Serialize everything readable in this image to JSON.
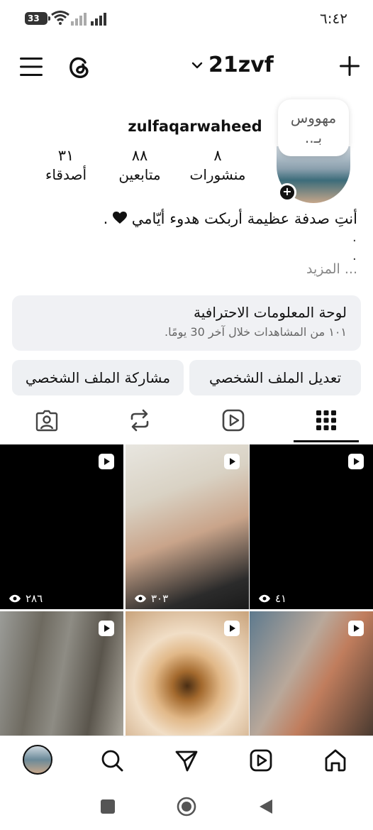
{
  "status_bar": {
    "battery": "33",
    "time": "٦:٤٢"
  },
  "header": {
    "username": "21zvf",
    "icons": [
      "menu-icon",
      "threads-icon",
      "chevron-down-icon",
      "plus-icon"
    ]
  },
  "profile": {
    "full_name": "zulfaqarwaheed",
    "note_line1": "مهووس",
    "note_line2": "بـ..",
    "stats": {
      "posts_value": "٨",
      "posts_label": "منشورات",
      "followers_value": "٨٨",
      "followers_label": "متابعين",
      "friends_value": "٣١",
      "friends_label": "أصدقاء"
    },
    "bio": "أنتِ صدفة عظيمة أربكت هدوء أيّامي",
    "bio_end": ".",
    "bio_dot": ".",
    "more": "... المزيد"
  },
  "dashboard": {
    "title": "لوحة المعلومات الاحترافية",
    "subtitle": "١٠١ من المشاهدات خلال آخر 30 يومًا."
  },
  "buttons": {
    "edit": "تعديل الملف الشخصي",
    "share": "مشاركة الملف الشخصي"
  },
  "tabs": [
    "grid-icon",
    "reels-icon",
    "reposts-icon",
    "tagged-icon"
  ],
  "grid": {
    "views": [
      "٤١",
      "٣٠٣",
      "٢٨٦"
    ]
  },
  "bottom_nav": [
    "home-icon",
    "reels-icon",
    "send-icon",
    "search-icon",
    "profile-avatar"
  ],
  "colors": {
    "text": "#111111",
    "secondary": "#888888",
    "surface": "#f0f1f4"
  }
}
